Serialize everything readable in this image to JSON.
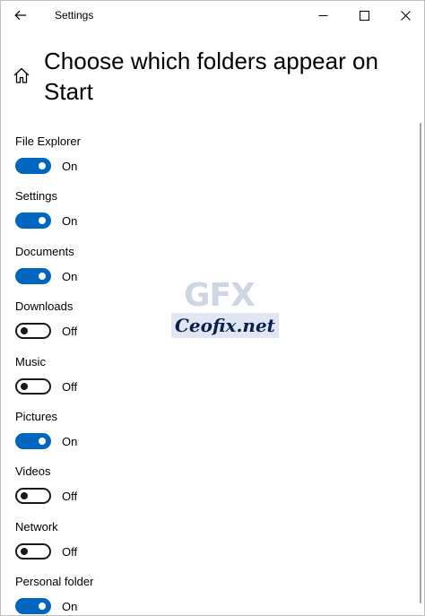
{
  "window": {
    "title": "Settings"
  },
  "header": {
    "title": "Choose which folders appear on Start"
  },
  "folders": [
    {
      "label": "File Explorer",
      "state": "On",
      "on": true
    },
    {
      "label": "Settings",
      "state": "On",
      "on": true
    },
    {
      "label": "Documents",
      "state": "On",
      "on": true
    },
    {
      "label": "Downloads",
      "state": "Off",
      "on": false
    },
    {
      "label": "Music",
      "state": "Off",
      "on": false
    },
    {
      "label": "Pictures",
      "state": "On",
      "on": true
    },
    {
      "label": "Videos",
      "state": "Off",
      "on": false
    },
    {
      "label": "Network",
      "state": "Off",
      "on": false
    },
    {
      "label": "Personal folder",
      "state": "On",
      "on": true
    }
  ],
  "watermark": {
    "logo_letters": "GFX",
    "text": "Ceofix.net"
  },
  "colors": {
    "accent": "#0067c0",
    "toggle_off_border": "#1a1a1a",
    "background": "#ffffff"
  },
  "icons": {
    "back": "back-arrow-icon",
    "home": "home-icon",
    "minimize": "minimize-icon",
    "maximize": "maximize-icon",
    "close": "close-icon"
  }
}
